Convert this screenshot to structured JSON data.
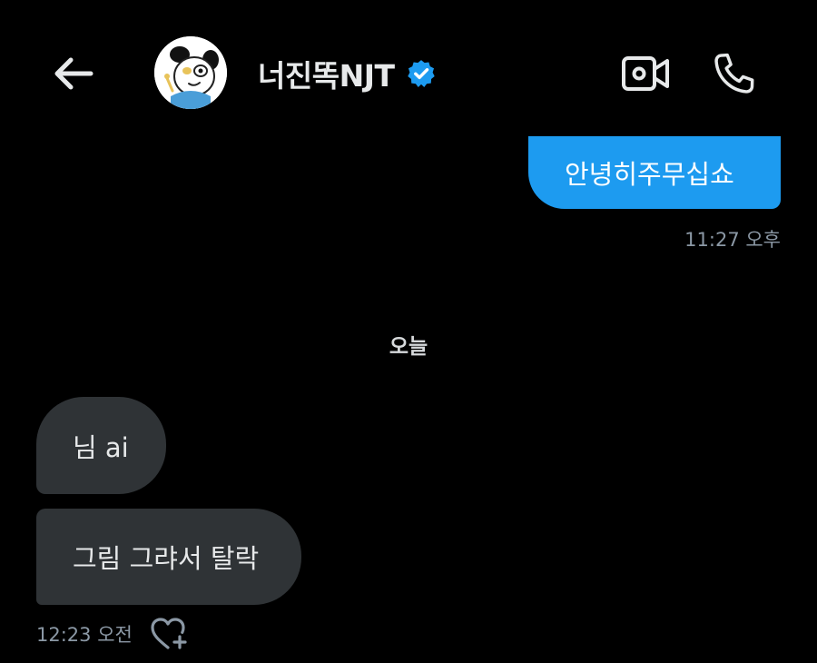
{
  "header": {
    "back_icon": "arrow-left-icon",
    "avatar_icon": "cartoon-avatar",
    "contact_name": "너진똑NJT",
    "verified_icon": "verified-badge-icon",
    "video_icon": "video-camera-icon",
    "call_icon": "phone-icon"
  },
  "messages": [
    {
      "direction": "outgoing",
      "text": "안녕히주무십쇼"
    },
    {
      "direction": "incoming",
      "text": "님 ai"
    },
    {
      "direction": "incoming",
      "text": "그림 그랴서 탈락"
    }
  ],
  "timestamps": {
    "outgoing": "11:27 오후",
    "incoming": "12:23 오전"
  },
  "date_separator": "오늘",
  "react_icon": "heart-plus-icon",
  "colors": {
    "background": "#000000",
    "outgoing_bubble": "#1d9bf0",
    "incoming_bubble": "#2f3336",
    "verified_badge": "#1d9bf0",
    "timestamp": "#8b98a5",
    "icons": "#e7e9ea"
  }
}
